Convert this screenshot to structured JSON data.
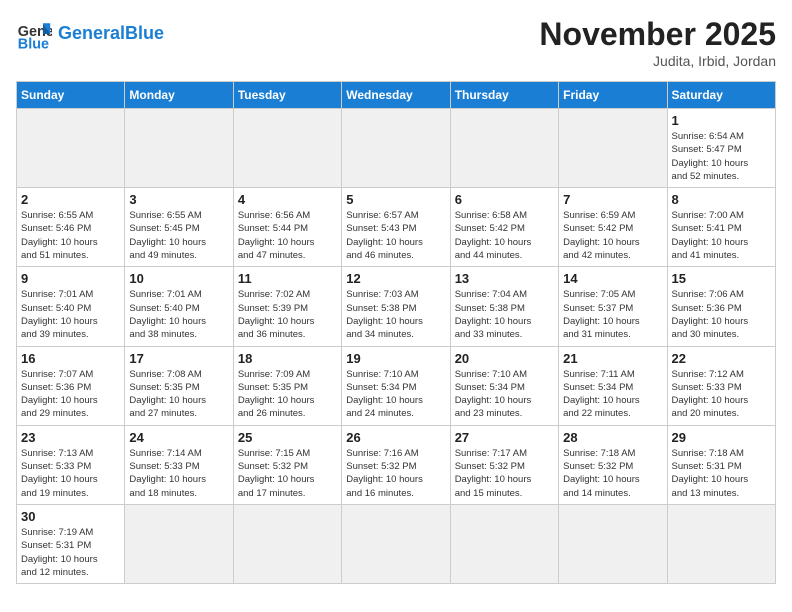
{
  "header": {
    "logo_general": "General",
    "logo_blue": "Blue",
    "month_title": "November 2025",
    "location": "Judita, Irbid, Jordan"
  },
  "days_of_week": [
    "Sunday",
    "Monday",
    "Tuesday",
    "Wednesday",
    "Thursday",
    "Friday",
    "Saturday"
  ],
  "weeks": [
    [
      {
        "day": "",
        "empty": true
      },
      {
        "day": "",
        "empty": true
      },
      {
        "day": "",
        "empty": true
      },
      {
        "day": "",
        "empty": true
      },
      {
        "day": "",
        "empty": true
      },
      {
        "day": "",
        "empty": true
      },
      {
        "day": "1",
        "sunrise": "6:54 AM",
        "sunset": "5:47 PM",
        "daylight": "10 hours and 52 minutes."
      }
    ],
    [
      {
        "day": "2",
        "sunrise": "6:55 AM",
        "sunset": "5:46 PM",
        "daylight": "10 hours and 51 minutes."
      },
      {
        "day": "3",
        "sunrise": "6:55 AM",
        "sunset": "5:45 PM",
        "daylight": "10 hours and 49 minutes."
      },
      {
        "day": "4",
        "sunrise": "6:56 AM",
        "sunset": "5:44 PM",
        "daylight": "10 hours and 47 minutes."
      },
      {
        "day": "5",
        "sunrise": "6:57 AM",
        "sunset": "5:43 PM",
        "daylight": "10 hours and 46 minutes."
      },
      {
        "day": "6",
        "sunrise": "6:58 AM",
        "sunset": "5:42 PM",
        "daylight": "10 hours and 44 minutes."
      },
      {
        "day": "7",
        "sunrise": "6:59 AM",
        "sunset": "5:42 PM",
        "daylight": "10 hours and 42 minutes."
      },
      {
        "day": "8",
        "sunrise": "7:00 AM",
        "sunset": "5:41 PM",
        "daylight": "10 hours and 41 minutes."
      }
    ],
    [
      {
        "day": "9",
        "sunrise": "7:01 AM",
        "sunset": "5:40 PM",
        "daylight": "10 hours and 39 minutes."
      },
      {
        "day": "10",
        "sunrise": "7:01 AM",
        "sunset": "5:40 PM",
        "daylight": "10 hours and 38 minutes."
      },
      {
        "day": "11",
        "sunrise": "7:02 AM",
        "sunset": "5:39 PM",
        "daylight": "10 hours and 36 minutes."
      },
      {
        "day": "12",
        "sunrise": "7:03 AM",
        "sunset": "5:38 PM",
        "daylight": "10 hours and 34 minutes."
      },
      {
        "day": "13",
        "sunrise": "7:04 AM",
        "sunset": "5:38 PM",
        "daylight": "10 hours and 33 minutes."
      },
      {
        "day": "14",
        "sunrise": "7:05 AM",
        "sunset": "5:37 PM",
        "daylight": "10 hours and 31 minutes."
      },
      {
        "day": "15",
        "sunrise": "7:06 AM",
        "sunset": "5:36 PM",
        "daylight": "10 hours and 30 minutes."
      }
    ],
    [
      {
        "day": "16",
        "sunrise": "7:07 AM",
        "sunset": "5:36 PM",
        "daylight": "10 hours and 29 minutes."
      },
      {
        "day": "17",
        "sunrise": "7:08 AM",
        "sunset": "5:35 PM",
        "daylight": "10 hours and 27 minutes."
      },
      {
        "day": "18",
        "sunrise": "7:09 AM",
        "sunset": "5:35 PM",
        "daylight": "10 hours and 26 minutes."
      },
      {
        "day": "19",
        "sunrise": "7:10 AM",
        "sunset": "5:34 PM",
        "daylight": "10 hours and 24 minutes."
      },
      {
        "day": "20",
        "sunrise": "7:10 AM",
        "sunset": "5:34 PM",
        "daylight": "10 hours and 23 minutes."
      },
      {
        "day": "21",
        "sunrise": "7:11 AM",
        "sunset": "5:34 PM",
        "daylight": "10 hours and 22 minutes."
      },
      {
        "day": "22",
        "sunrise": "7:12 AM",
        "sunset": "5:33 PM",
        "daylight": "10 hours and 20 minutes."
      }
    ],
    [
      {
        "day": "23",
        "sunrise": "7:13 AM",
        "sunset": "5:33 PM",
        "daylight": "10 hours and 19 minutes."
      },
      {
        "day": "24",
        "sunrise": "7:14 AM",
        "sunset": "5:33 PM",
        "daylight": "10 hours and 18 minutes."
      },
      {
        "day": "25",
        "sunrise": "7:15 AM",
        "sunset": "5:32 PM",
        "daylight": "10 hours and 17 minutes."
      },
      {
        "day": "26",
        "sunrise": "7:16 AM",
        "sunset": "5:32 PM",
        "daylight": "10 hours and 16 minutes."
      },
      {
        "day": "27",
        "sunrise": "7:17 AM",
        "sunset": "5:32 PM",
        "daylight": "10 hours and 15 minutes."
      },
      {
        "day": "28",
        "sunrise": "7:18 AM",
        "sunset": "5:32 PM",
        "daylight": "10 hours and 14 minutes."
      },
      {
        "day": "29",
        "sunrise": "7:18 AM",
        "sunset": "5:31 PM",
        "daylight": "10 hours and 13 minutes."
      }
    ],
    [
      {
        "day": "30",
        "sunrise": "7:19 AM",
        "sunset": "5:31 PM",
        "daylight": "10 hours and 12 minutes."
      },
      {
        "day": "",
        "empty": true
      },
      {
        "day": "",
        "empty": true
      },
      {
        "day": "",
        "empty": true
      },
      {
        "day": "",
        "empty": true
      },
      {
        "day": "",
        "empty": true
      },
      {
        "day": "",
        "empty": true
      }
    ]
  ],
  "labels": {
    "sunrise": "Sunrise:",
    "sunset": "Sunset:",
    "daylight": "Daylight:"
  }
}
